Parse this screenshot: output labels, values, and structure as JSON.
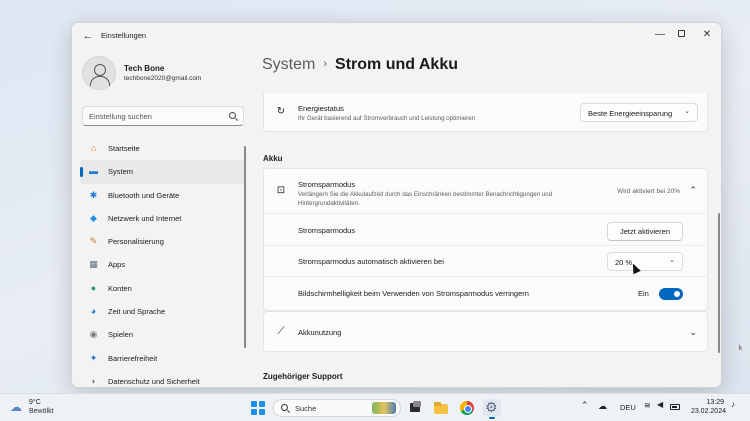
{
  "window": {
    "app_title": "Einstellungen",
    "back_icon": "arrow-left-icon"
  },
  "profile": {
    "name": "Tech Bone",
    "email": "techbone2020@gmail.com"
  },
  "search": {
    "placeholder": "Einstellung suchen"
  },
  "sidebar": {
    "items": [
      {
        "label": "Startseite",
        "icon": "home-icon",
        "glyph": "⌂",
        "color": "#d9822b"
      },
      {
        "label": "System",
        "icon": "monitor-icon",
        "glyph": "▬",
        "color": "#1f7ad8",
        "active": true
      },
      {
        "label": "Bluetooth und Geräte",
        "icon": "bluetooth-icon",
        "glyph": "✱",
        "color": "#1f7ad8"
      },
      {
        "label": "Netzwerk und Internet",
        "icon": "wifi-icon",
        "glyph": "◆",
        "color": "#1f8fe8"
      },
      {
        "label": "Personalisierung",
        "icon": "brush-icon",
        "glyph": "✎",
        "color": "#c8782a"
      },
      {
        "label": "Apps",
        "icon": "apps-icon",
        "glyph": "▦",
        "color": "#5c6b82"
      },
      {
        "label": "Konten",
        "icon": "account-icon",
        "glyph": "●",
        "color": "#2e9c6a"
      },
      {
        "label": "Zeit und Sprache",
        "icon": "globe-clock-icon",
        "glyph": "◕",
        "color": "#1f7ad8"
      },
      {
        "label": "Spielen",
        "icon": "gamepad-icon",
        "glyph": "◉",
        "color": "#7a7a7a"
      },
      {
        "label": "Barrierefreiheit",
        "icon": "accessibility-icon",
        "glyph": "✦",
        "color": "#1f6fd0"
      },
      {
        "label": "Datenschutz und Sicherheit",
        "icon": "shield-icon",
        "glyph": "◗",
        "color": "#7a7a7a"
      }
    ]
  },
  "breadcrumb": {
    "parent": "System",
    "separator": "›",
    "current": "Strom und Akku"
  },
  "energy_status": {
    "title": "Energiestatus",
    "subtitle": "Ihr Gerät basierend auf Stromverbrauch und Leistung optimieren",
    "dropdown_value": "Beste Energieeinsparung"
  },
  "akku_section": {
    "label": "Akku",
    "stromsparmodus": {
      "title": "Stromsparmodus",
      "subtitle": "Verlängern Sie die Akkulaufzeit durch das Einschränken bestimmter Benachrichtigungen und Hintergrundaktivitäten.",
      "status": "Wird aktiviert bei 20%",
      "rows": {
        "activate_label": "Stromsparmodus",
        "activate_button": "Jetzt aktivieren",
        "auto_label": "Stromsparmodus automatisch aktivieren bei",
        "auto_value": "20 %",
        "brightness_label": "Bildschirmhelligkeit beim Verwenden von Stromsparmodus verringern",
        "brightness_toggle_label": "Ein",
        "brightness_toggle_on": true
      }
    },
    "akkunutzung": {
      "title": "Akkunutzung"
    }
  },
  "support_section": {
    "label": "Zugehöriger Support"
  },
  "taskbar": {
    "weather_temp": "9°C",
    "weather_desc": "Bewölkt",
    "search_text": "Suche",
    "language": "DEU",
    "time": "13:29",
    "date": "23.02.2024"
  },
  "colors": {
    "accent": "#0067c0",
    "window_bg": "#f3f3f3",
    "card_bg": "#fbfbfb"
  }
}
